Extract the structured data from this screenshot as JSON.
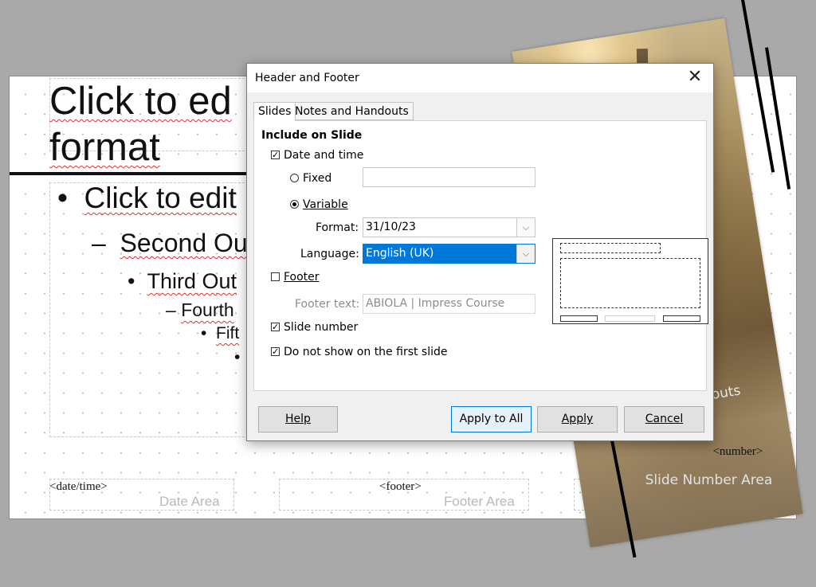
{
  "slide": {
    "title_lines": [
      "Click to ed",
      "format"
    ],
    "outline": [
      {
        "bullet": "•",
        "text": "Click to edit"
      },
      {
        "bullet": "–",
        "text": "Second Ou"
      },
      {
        "bullet": "•",
        "text": "Third Out"
      },
      {
        "bullet": "–",
        "text": "Fourth"
      },
      {
        "bullet": "•",
        "text": "Fift"
      },
      {
        "bullet": "•",
        "text": ""
      }
    ],
    "footer": {
      "date_tag": "<date/time>",
      "date_area": "Date Area",
      "footer_tag": "<footer>",
      "footer_area": "Footer Area",
      "number_tag": "<number>",
      "number_area": "Slide Number Area"
    },
    "photo_caption": "youts"
  },
  "dialog": {
    "title": "Header and Footer",
    "close_glyph": "✕",
    "tabs": [
      "Slides",
      "Notes and Handouts"
    ],
    "section_title": "Include on Slide",
    "date_time": {
      "label": "Date and time",
      "checked": true
    },
    "fixed": {
      "label": "Fixed",
      "value": ""
    },
    "variable": {
      "label": "Variable",
      "selected": true
    },
    "format": {
      "label": "Format:",
      "value": "31/10/23"
    },
    "language": {
      "label": "Language:",
      "value": "English (UK)"
    },
    "footer_checkbox": {
      "label": "Footer",
      "checked": false
    },
    "footer_text": {
      "label": "Footer text:",
      "value": "ABIOLA | Impress Course"
    },
    "slide_number": {
      "label": "Slide number",
      "checked": true
    },
    "not_first": {
      "label": "Do not show on the first slide",
      "checked": true
    },
    "buttons": {
      "help": "Help",
      "apply_all": "Apply to All",
      "apply": "Apply",
      "cancel": "Cancel"
    },
    "check_glyph": "✓",
    "dropdown_glyph": "⌵"
  }
}
